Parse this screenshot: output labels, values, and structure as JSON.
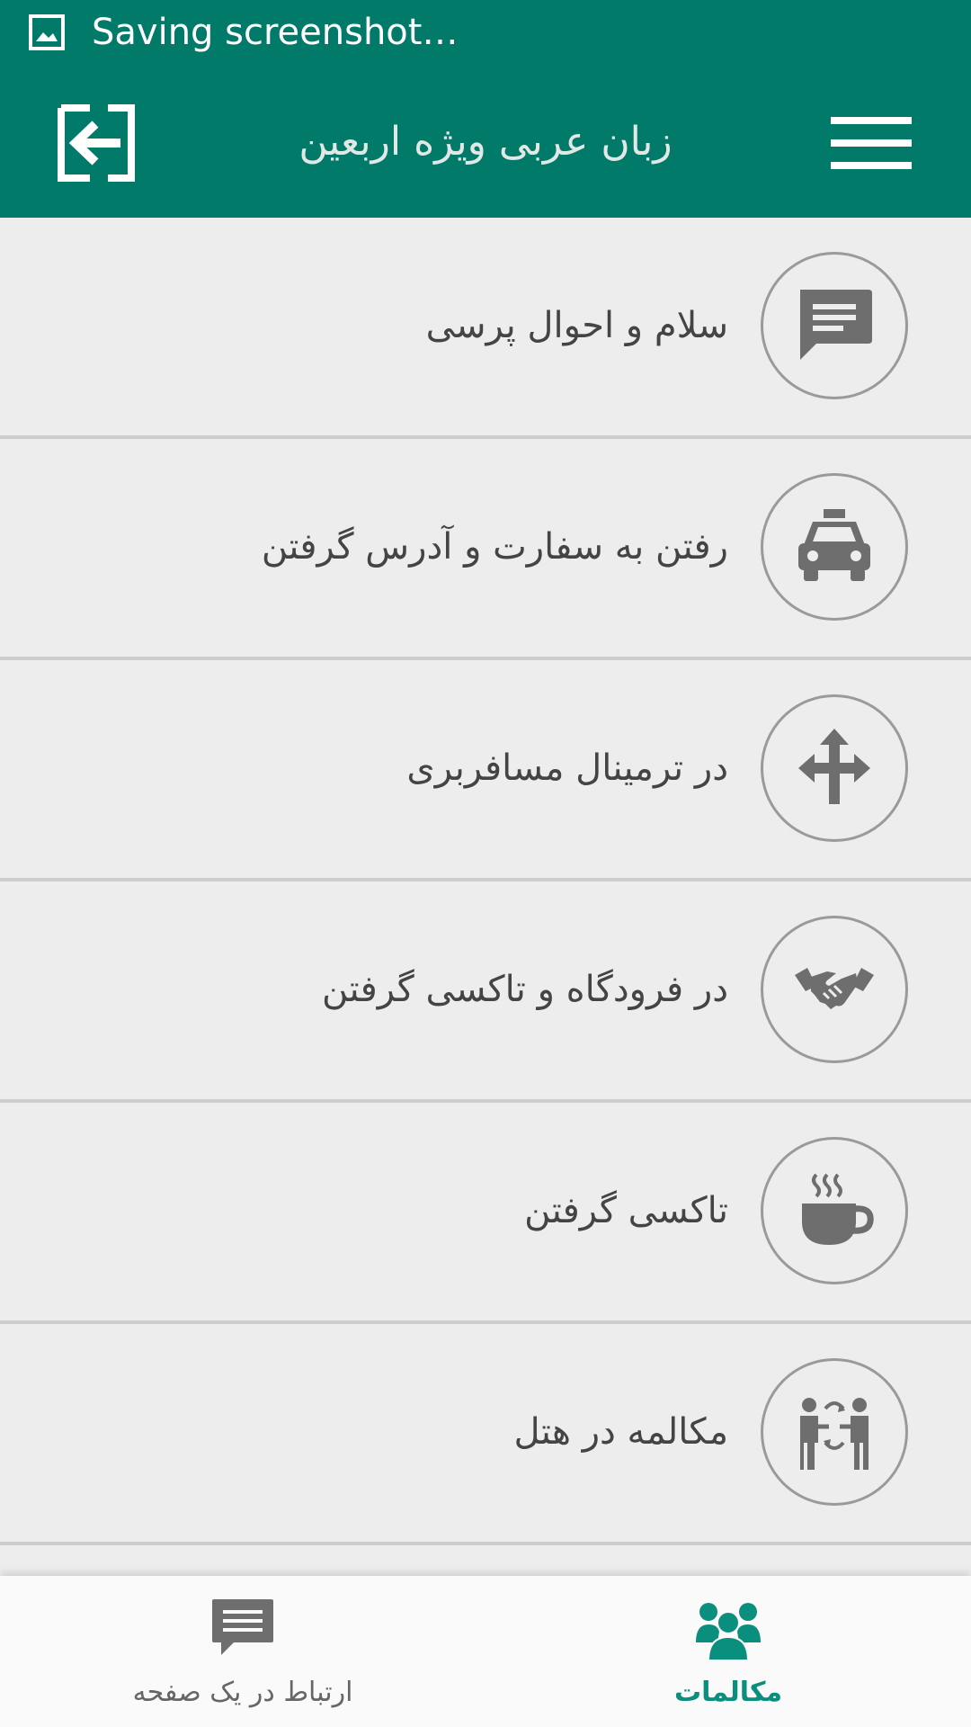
{
  "status_bar": {
    "notification_text": "Saving screenshot…",
    "icon": "image-icon"
  },
  "app_bar": {
    "title": "زبان عربی ویژه اربعین",
    "back_icon": "exit-arrow-icon",
    "menu_icon": "hamburger-menu-icon"
  },
  "list": {
    "items": [
      {
        "label": "سلام و احوال پرسی",
        "icon": "chat-icon"
      },
      {
        "label": "رفتن به سفارت و آدرس گرفتن",
        "icon": "taxi-icon"
      },
      {
        "label": "در ترمینال مسافربری",
        "icon": "directions-icon"
      },
      {
        "label": "در فرودگاه و تاکسی گرفتن",
        "icon": "handshake-icon"
      },
      {
        "label": "تاکسی گرفتن",
        "icon": "coffee-icon"
      },
      {
        "label": "مکالمه در هتل",
        "icon": "exchange-people-icon"
      }
    ]
  },
  "bottom_nav": {
    "items": [
      {
        "label": "ارتباط در یک صفحه",
        "icon": "message-icon",
        "active": false
      },
      {
        "label": "مکالمات",
        "icon": "group-icon",
        "active": true
      }
    ]
  },
  "colors": {
    "primary": "#017a6a",
    "accent": "#0a8e7d",
    "background": "#ededed",
    "icon_gray": "#6e6e6e"
  }
}
